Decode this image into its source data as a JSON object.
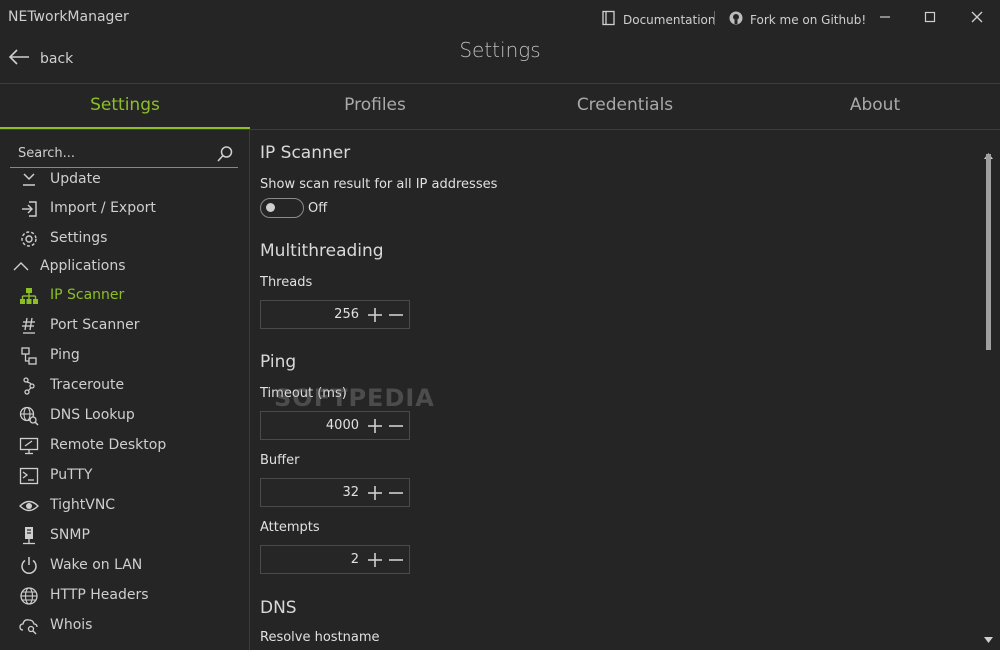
{
  "app": {
    "title": "NETworkManager"
  },
  "titlebar": {
    "documentation": "Documentation",
    "github": "Fork me on Github!"
  },
  "header": {
    "back": "back",
    "title": "Settings"
  },
  "tabs": [
    {
      "label": "Settings"
    },
    {
      "label": "Profiles"
    },
    {
      "label": "Credentials"
    },
    {
      "label": "About"
    }
  ],
  "search": {
    "placeholder": "Search..."
  },
  "sidebar": {
    "items": [
      {
        "label": "Update",
        "icon": "download-icon"
      },
      {
        "label": "Import / Export",
        "icon": "import-icon"
      },
      {
        "label": "Settings",
        "icon": "gear-icon"
      },
      {
        "label": "Applications",
        "icon": "chevron-up-icon"
      },
      {
        "label": "IP Scanner",
        "icon": "network-tree-icon"
      },
      {
        "label": "Port Scanner",
        "icon": "hash-icon"
      },
      {
        "label": "Ping",
        "icon": "ping-icon"
      },
      {
        "label": "Traceroute",
        "icon": "traceroute-icon"
      },
      {
        "label": "DNS Lookup",
        "icon": "globe-search-icon"
      },
      {
        "label": "Remote Desktop",
        "icon": "remote-desktop-icon"
      },
      {
        "label": "PuTTY",
        "icon": "terminal-icon"
      },
      {
        "label": "TightVNC",
        "icon": "eye-icon"
      },
      {
        "label": "SNMP",
        "icon": "server-icon"
      },
      {
        "label": "Wake on LAN",
        "icon": "power-icon"
      },
      {
        "label": "HTTP Headers",
        "icon": "globe-icon"
      },
      {
        "label": "Whois",
        "icon": "cloud-search-icon"
      }
    ]
  },
  "content": {
    "ip_scanner": {
      "heading": "IP Scanner",
      "show_all_label": "Show scan result for all IP addresses",
      "show_all_state": "Off"
    },
    "multithreading": {
      "heading": "Multithreading",
      "threads_label": "Threads",
      "threads_value": "256"
    },
    "ping": {
      "heading": "Ping",
      "timeout_label": "Timeout (ms)",
      "timeout_value": "4000",
      "buffer_label": "Buffer",
      "buffer_value": "32",
      "attempts_label": "Attempts",
      "attempts_value": "2"
    },
    "dns": {
      "heading": "DNS",
      "resolve_label": "Resolve hostname"
    }
  },
  "watermark": "SOFTPEDIA",
  "colors": {
    "accent": "#8cbf26",
    "background": "#252525"
  }
}
